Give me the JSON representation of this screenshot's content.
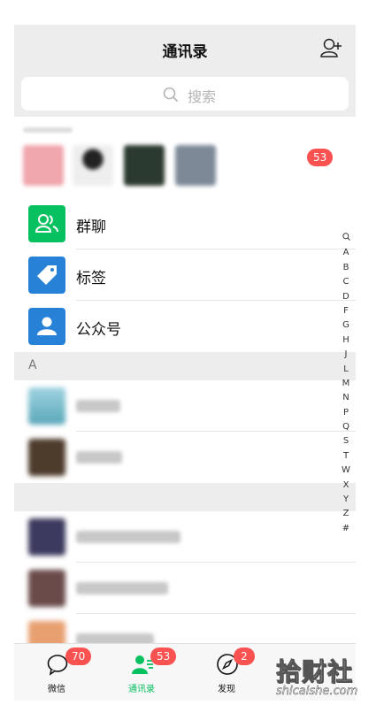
{
  "header": {
    "title": "通讯录"
  },
  "search": {
    "placeholder": "搜索"
  },
  "recent": {
    "badge": "53"
  },
  "functions": [
    {
      "label": "群聊",
      "color": "#07c160",
      "icon": "group-icon"
    },
    {
      "label": "标签",
      "color": "#2782d7",
      "icon": "tag-icon"
    },
    {
      "label": "公众号",
      "color": "#2782d7",
      "icon": "official-account-icon"
    }
  ],
  "sections": [
    {
      "letter": "A"
    },
    {
      "letter": ""
    }
  ],
  "index": [
    "A",
    "B",
    "C",
    "D",
    "F",
    "G",
    "H",
    "J",
    "L",
    "M",
    "N",
    "P",
    "Q",
    "S",
    "T",
    "W",
    "X",
    "Y",
    "Z",
    "#"
  ],
  "tabs": [
    {
      "label": "微信",
      "badge": "70",
      "icon": "chat-icon"
    },
    {
      "label": "通讯录",
      "badge": "53",
      "icon": "contacts-icon"
    },
    {
      "label": "发现",
      "badge": "2",
      "icon": "compass-icon"
    }
  ],
  "watermark": {
    "main": "拾财社",
    "sub": "shicaishe.com"
  },
  "colors": {
    "accent": "#07c160",
    "badge": "#fa5151",
    "blue": "#2782d7"
  }
}
